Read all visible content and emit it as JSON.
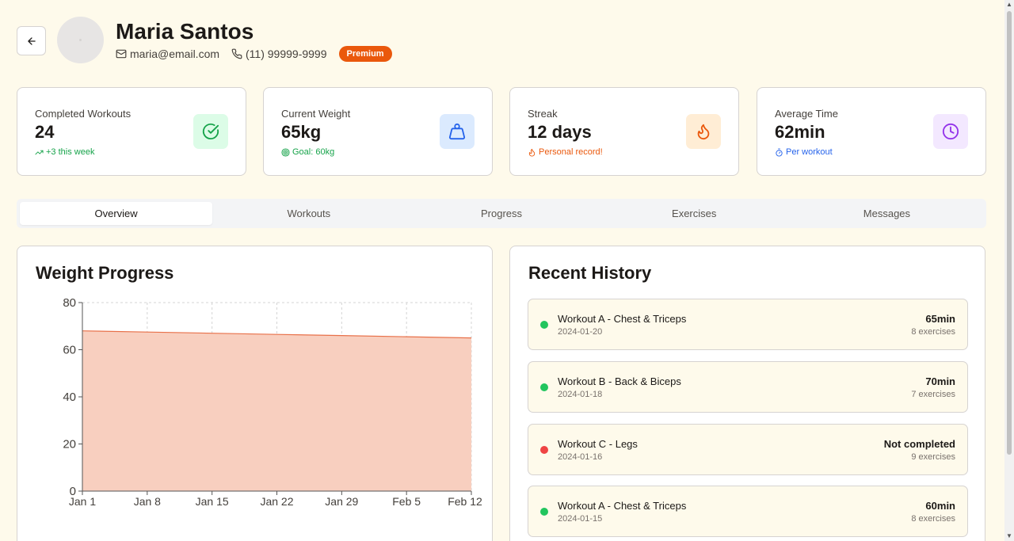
{
  "profile": {
    "name": "Maria Santos",
    "email": "maria@email.com",
    "phone": "(11) 99999-9999",
    "plan": "Premium"
  },
  "stats": [
    {
      "label": "Completed Workouts",
      "value": "24",
      "sub": "+3 this week",
      "sub_color": "#16a34a",
      "icon": "check-circle-icon",
      "icon_bg": "#dcfce7",
      "icon_color": "#16a34a"
    },
    {
      "label": "Current Weight",
      "value": "65kg",
      "sub": "Goal: 60kg",
      "sub_color": "#16a34a",
      "icon": "weight-icon",
      "icon_bg": "#dbeafe",
      "icon_color": "#2563eb"
    },
    {
      "label": "Streak",
      "value": "12 days",
      "sub": "Personal record!",
      "sub_color": "#ea580c",
      "icon": "flame-icon",
      "icon_bg": "#ffedd5",
      "icon_color": "#ea580c"
    },
    {
      "label": "Average Time",
      "value": "62min",
      "sub": "Per workout",
      "sub_color": "#2563eb",
      "icon": "clock-icon",
      "icon_bg": "#f3e8ff",
      "icon_color": "#9333ea"
    }
  ],
  "tabs": [
    "Overview",
    "Workouts",
    "Progress",
    "Exercises",
    "Messages"
  ],
  "active_tab": "Overview",
  "weight_panel": {
    "title": "Weight Progress"
  },
  "chart_data": {
    "type": "area",
    "x": [
      "Jan 1",
      "Jan 8",
      "Jan 15",
      "Jan 22",
      "Jan 29",
      "Feb 5",
      "Feb 12"
    ],
    "series": [
      {
        "values": [
          68,
          67.5,
          67,
          66.5,
          66,
          65.5,
          65
        ],
        "color": "#e8714a",
        "fill": "#f8cfbf"
      }
    ],
    "ylim": [
      0,
      80
    ],
    "yticks": [
      0,
      20,
      40,
      60,
      80
    ],
    "grid": true
  },
  "history_panel": {
    "title": "Recent History"
  },
  "history": [
    {
      "name": "Workout A - Chest & Triceps",
      "date": "2024-01-20",
      "time": "65min",
      "exercises": "8 exercises",
      "status_color": "#22c55e"
    },
    {
      "name": "Workout B - Back & Biceps",
      "date": "2024-01-18",
      "time": "70min",
      "exercises": "7 exercises",
      "status_color": "#22c55e"
    },
    {
      "name": "Workout C - Legs",
      "date": "2024-01-16",
      "time": "Not completed",
      "exercises": "9 exercises",
      "status_color": "#ef4444"
    },
    {
      "name": "Workout A - Chest & Triceps",
      "date": "2024-01-15",
      "time": "60min",
      "exercises": "8 exercises",
      "status_color": "#22c55e"
    }
  ]
}
